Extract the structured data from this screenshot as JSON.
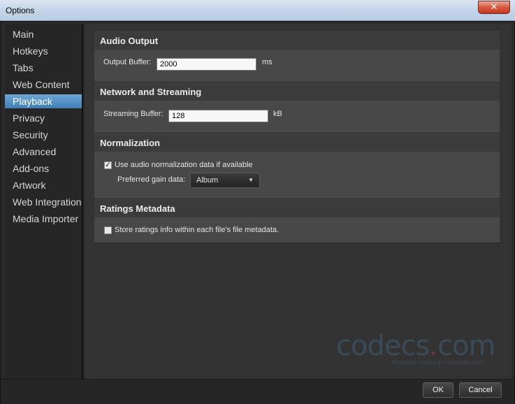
{
  "window": {
    "title": "Options",
    "close_glyph": "✕"
  },
  "sidebar": {
    "items": [
      {
        "label": "Main"
      },
      {
        "label": "Hotkeys"
      },
      {
        "label": "Tabs"
      },
      {
        "label": "Web Content"
      },
      {
        "label": "Playback",
        "selected": true
      },
      {
        "label": "Privacy"
      },
      {
        "label": "Security"
      },
      {
        "label": "Advanced"
      },
      {
        "label": "Add-ons"
      },
      {
        "label": "Artwork"
      },
      {
        "label": "Web Integration"
      },
      {
        "label": "Media Importer"
      }
    ]
  },
  "sections": {
    "audio_output": {
      "title": "Audio Output",
      "output_buffer_label": "Output Buffer:",
      "output_buffer_value": "2000",
      "output_buffer_unit": "ms"
    },
    "network": {
      "title": "Network and Streaming",
      "streaming_buffer_label": "Streaming Buffer:",
      "streaming_buffer_value": "128",
      "streaming_buffer_unit": "kB"
    },
    "normalization": {
      "title": "Normalization",
      "use_normalization_label": "Use audio normalization data if available",
      "use_normalization_checked": true,
      "preferred_gain_label": "Preferred gain data:",
      "preferred_gain_value": "Album"
    },
    "ratings": {
      "title": "Ratings Metadata",
      "store_ratings_label": "Store ratings info within each file's file metadata.",
      "store_ratings_checked": false
    }
  },
  "watermark": {
    "brand": "codecs",
    "dot": ".",
    "tld": "com",
    "tagline": "Download codecs & multimedia tools"
  },
  "footer": {
    "ok_label": "OK",
    "cancel_label": "Cancel"
  },
  "colors": {
    "accent": "#4a8cc4",
    "panel": "#333333",
    "section_body": "#484848"
  }
}
